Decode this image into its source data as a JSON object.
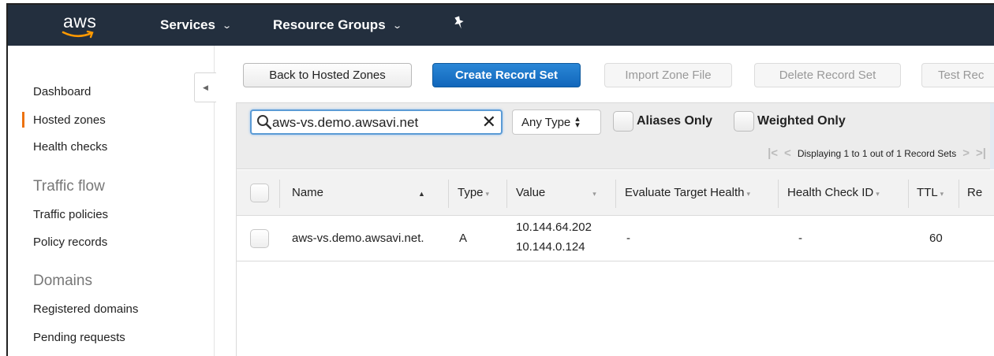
{
  "topnav": {
    "logo_text": "aws",
    "services_label": "Services",
    "resource_groups_label": "Resource Groups",
    "chevron": "⌄",
    "pin_icon": "pin-icon"
  },
  "sidebar": {
    "items": [
      {
        "label": "Dashboard"
      },
      {
        "label": "Hosted zones",
        "active": true
      },
      {
        "label": "Health checks"
      }
    ],
    "sections": [
      {
        "title": "Traffic flow",
        "items": [
          {
            "label": "Traffic policies"
          },
          {
            "label": "Policy records"
          }
        ]
      },
      {
        "title": "Domains",
        "items": [
          {
            "label": "Registered domains"
          },
          {
            "label": "Pending requests"
          }
        ]
      }
    ],
    "collapse_icon": "◀"
  },
  "toolbar": {
    "back_label": "Back to Hosted Zones",
    "create_label": "Create Record Set",
    "import_label": "Import Zone File",
    "delete_label": "Delete Record Set",
    "test_label": "Test Rec"
  },
  "filter": {
    "search_value": "aws-vs.demo.awsavi.net",
    "clear_glyph": "✕",
    "type_value": "Any Type",
    "aliases_label": "Aliases Only",
    "weighted_label": "Weighted Only",
    "pager_text": "Displaying 1 to 1 out of 1 Record Sets"
  },
  "table": {
    "columns": [
      "Name",
      "Type",
      "Value",
      "Evaluate Target Health",
      "Health Check ID",
      "TTL",
      "Re"
    ],
    "rows": [
      {
        "name": "aws-vs.demo.awsavi.net.",
        "type": "A",
        "value_line1": "10.144.64.202",
        "value_line2": "10.144.0.124",
        "evaluate_target_health": "-",
        "health_check_id": "-",
        "ttl": "60"
      }
    ]
  },
  "colors": {
    "topnav_bg": "#232f3e",
    "primary_button": "#1a73c8",
    "active_indicator": "#ec7211"
  }
}
